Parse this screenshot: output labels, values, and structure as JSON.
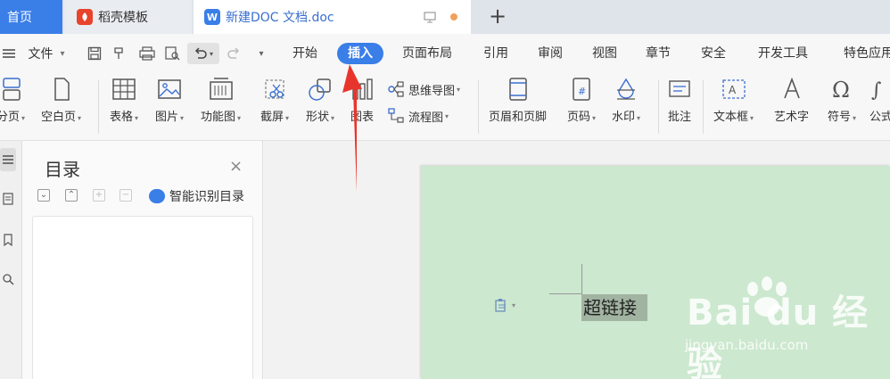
{
  "tabs": {
    "home": "首页",
    "templates": "稻壳模板",
    "doc": "新建DOC 文档.doc",
    "doc_icon": "W"
  },
  "menubar": {
    "file": "文件",
    "tabs": [
      "开始",
      "插入",
      "页面布局",
      "引用",
      "审阅",
      "视图",
      "章节",
      "安全",
      "开发工具",
      "特色应用"
    ],
    "active": "插入"
  },
  "ribbon": {
    "page_break": "分页",
    "blank_page": "空白页",
    "table": "表格",
    "picture": "图片",
    "function_chart": "功能图",
    "screenshot": "截屏",
    "shape": "形状",
    "chart": "图表",
    "mind_map": "思维导图",
    "flowchart": "流程图",
    "header_footer": "页眉和页脚",
    "page_number": "页码",
    "watermark": "水印",
    "comment": "批注",
    "text_box": "文本框",
    "word_art": "艺术字",
    "symbol": "符号",
    "formula": "公式"
  },
  "toc": {
    "title": "目录",
    "close": "×",
    "smart_toc": "智能识别目录"
  },
  "document": {
    "text": "超链接"
  },
  "watermark": {
    "main": "Bai du 经验",
    "sub": "jingyan.baidu.com"
  },
  "colors": {
    "accent": "#3a7ee8",
    "page_bg": "#cce8cf",
    "selection": "#a1b3a1",
    "arrow": "#e8352c"
  }
}
